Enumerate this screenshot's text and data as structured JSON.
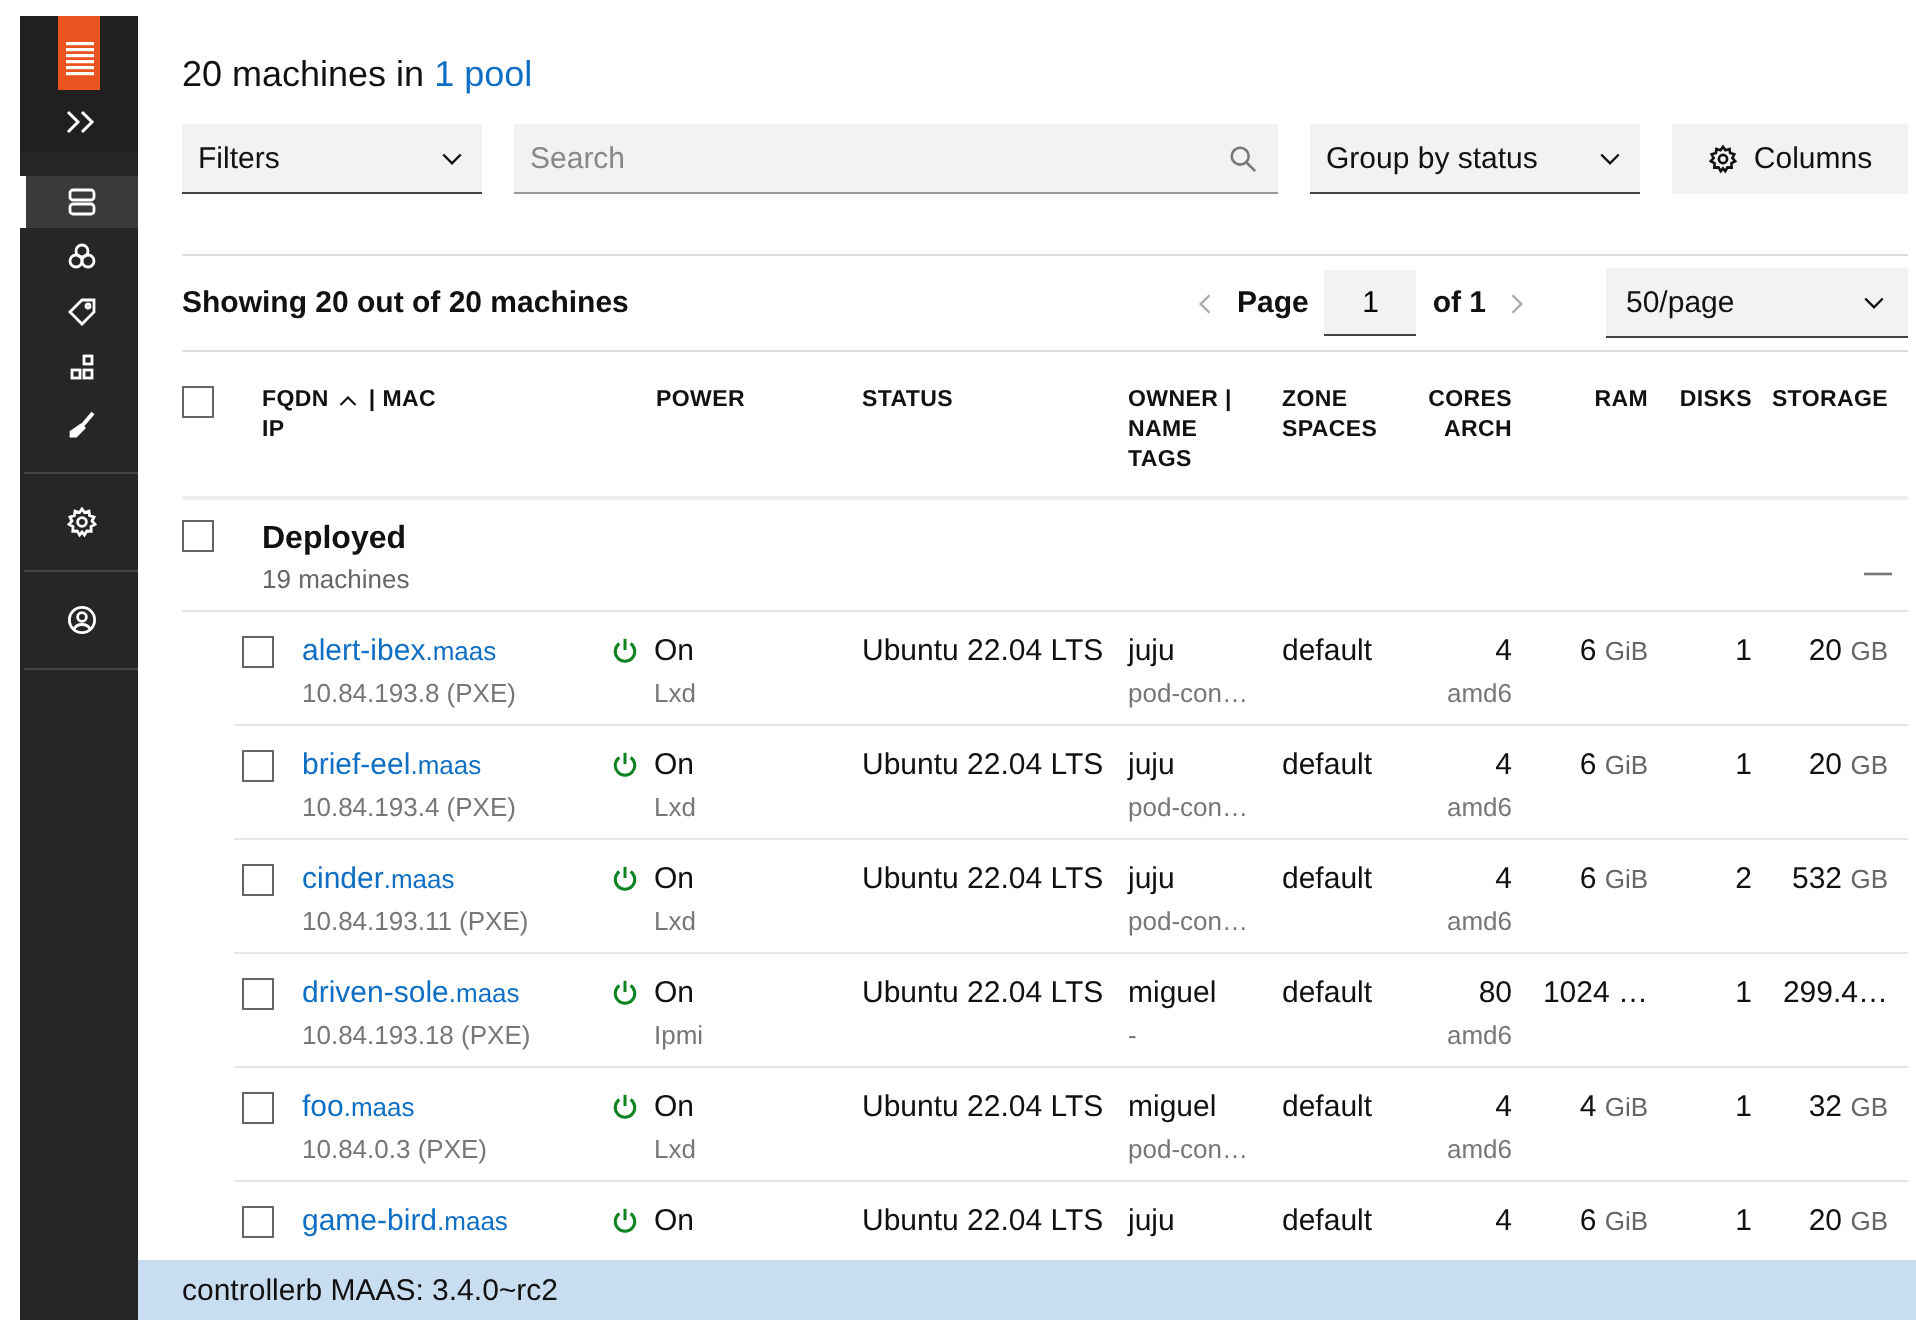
{
  "sidebar": {
    "items": [
      {
        "selected": true
      },
      {
        "selected": false
      },
      {
        "selected": false
      },
      {
        "selected": false
      },
      {
        "selected": false
      },
      {
        "selected": false
      },
      {
        "selected": false
      }
    ]
  },
  "header": {
    "title": "20 machines in",
    "pool_link": "1 pool"
  },
  "toolbar": {
    "filters": "Filters",
    "search": {
      "placeholder": "Search"
    },
    "group_by": "Group by status",
    "columns_button": "Columns"
  },
  "pagination": {
    "summary": "Showing 20 out of 20 machines",
    "page_label": "Page",
    "page": "1",
    "of": "of 1",
    "per_page": "50/page"
  },
  "table": {
    "select_all_checked": false,
    "fqdn_column": {
      "label": "FQDN",
      "sort_ascending": true,
      "label_2": "| MAC",
      "line_2": "IP"
    },
    "columns": [
      {
        "lines": [
          "POWER"
        ]
      },
      {
        "lines": [
          "STATUS"
        ]
      },
      {
        "lines": [
          "OWNER |",
          "NAME",
          "TAGS"
        ]
      },
      {
        "lines": [
          "ZONE",
          "SPACES"
        ]
      },
      {
        "lines": [
          "CORES",
          "ARCH"
        ]
      },
      {
        "lines": [
          "RAM"
        ]
      },
      {
        "lines": [
          "DISKS"
        ]
      },
      {
        "lines": [
          "STORAGE"
        ]
      }
    ],
    "group": {
      "name": "Deployed",
      "count": "19 machines",
      "checked": false,
      "expanded": true
    },
    "rows": [
      {
        "name": "alert-ibex",
        "domain": ".maas",
        "ip": "10.84.193.8 (PXE)",
        "power_on": true,
        "power": "On",
        "power_type": "Lxd",
        "status": "Ubuntu 22.04 LTS",
        "owner": "juju",
        "tags": "pod-con…",
        "zone": "default",
        "cores": "4",
        "arch": "amd6",
        "ram": {
          "value": "6",
          "unit": "GiB"
        },
        "disks": "1",
        "storage": {
          "value": "20",
          "unit": "GB"
        },
        "checked": false
      },
      {
        "name": "brief-eel",
        "domain": ".maas",
        "ip": "10.84.193.4 (PXE)",
        "power_on": true,
        "power": "On",
        "power_type": "Lxd",
        "status": "Ubuntu 22.04 LTS",
        "owner": "juju",
        "tags": "pod-con…",
        "zone": "default",
        "cores": "4",
        "arch": "amd6",
        "ram": {
          "value": "6",
          "unit": "GiB"
        },
        "disks": "1",
        "storage": {
          "value": "20",
          "unit": "GB"
        },
        "checked": false
      },
      {
        "name": "cinder",
        "domain": ".maas",
        "ip": "10.84.193.11 (PXE)",
        "power_on": true,
        "power": "On",
        "power_type": "Lxd",
        "status": "Ubuntu 22.04 LTS",
        "owner": "juju",
        "tags": "pod-con…",
        "zone": "default",
        "cores": "4",
        "arch": "amd6",
        "ram": {
          "value": "6",
          "unit": "GiB"
        },
        "disks": "2",
        "storage": {
          "value": "532",
          "unit": "GB"
        },
        "checked": false
      },
      {
        "name": "driven-sole",
        "domain": ".maas",
        "ip": "10.84.193.18 (PXE)",
        "power_on": true,
        "power": "On",
        "power_type": "Ipmi",
        "status": "Ubuntu 22.04 LTS",
        "owner": "miguel",
        "tags": "-",
        "zone": "default",
        "cores": "80",
        "arch": "amd6",
        "ram": {
          "value": "1024 …"
        },
        "disks": "1",
        "storage": {
          "value": "299.4…"
        },
        "checked": false
      },
      {
        "name": "foo",
        "domain": ".maas",
        "ip": "10.84.0.3 (PXE)",
        "power_on": true,
        "power": "On",
        "power_type": "Lxd",
        "status": "Ubuntu 22.04 LTS",
        "owner": "miguel",
        "tags": "pod-con…",
        "zone": "default",
        "cores": "4",
        "arch": "amd6",
        "ram": {
          "value": "4",
          "unit": "GiB"
        },
        "disks": "1",
        "storage": {
          "value": "32",
          "unit": "GB"
        },
        "checked": false
      },
      {
        "name": "game-bird",
        "domain": ".maas",
        "power_on": true,
        "power": "On",
        "status": "Ubuntu 22.04 LTS",
        "owner": "juju",
        "zone": "default",
        "cores": "4",
        "ram": {
          "value": "6",
          "unit": "GiB"
        },
        "disks": "1",
        "storage": {
          "value": "20",
          "unit": "GB"
        },
        "checked": false
      }
    ]
  },
  "status_bar": "controllerb MAAS: 3.4.0~rc2"
}
